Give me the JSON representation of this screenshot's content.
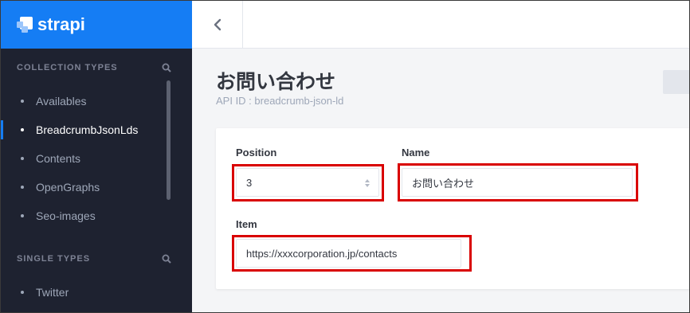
{
  "brand": {
    "name": "strapi"
  },
  "sidebar": {
    "collection_types": {
      "heading": "COLLECTION TYPES",
      "items": [
        {
          "label": "Availables",
          "active": false
        },
        {
          "label": "BreadcrumbJsonLds",
          "active": true
        },
        {
          "label": "Contents",
          "active": false
        },
        {
          "label": "OpenGraphs",
          "active": false
        },
        {
          "label": "Seo-images",
          "active": false
        }
      ]
    },
    "single_types": {
      "heading": "SINGLE TYPES",
      "items": [
        {
          "label": "Twitter",
          "active": false
        }
      ]
    }
  },
  "header": {
    "back_icon": "chevron-left-icon"
  },
  "page": {
    "title": "お問い合わせ",
    "api_id": "API ID : breadcrumb-json-ld"
  },
  "form": {
    "position": {
      "label": "Position",
      "value": "3"
    },
    "name": {
      "label": "Name",
      "value": "お問い合わせ"
    },
    "item": {
      "label": "Item",
      "value": "https://xxxcorporation.jp/contacts"
    }
  },
  "colors": {
    "brand_blue": "#157df4",
    "sidebar_bg": "#1e2230",
    "highlight_red": "#d90000"
  }
}
